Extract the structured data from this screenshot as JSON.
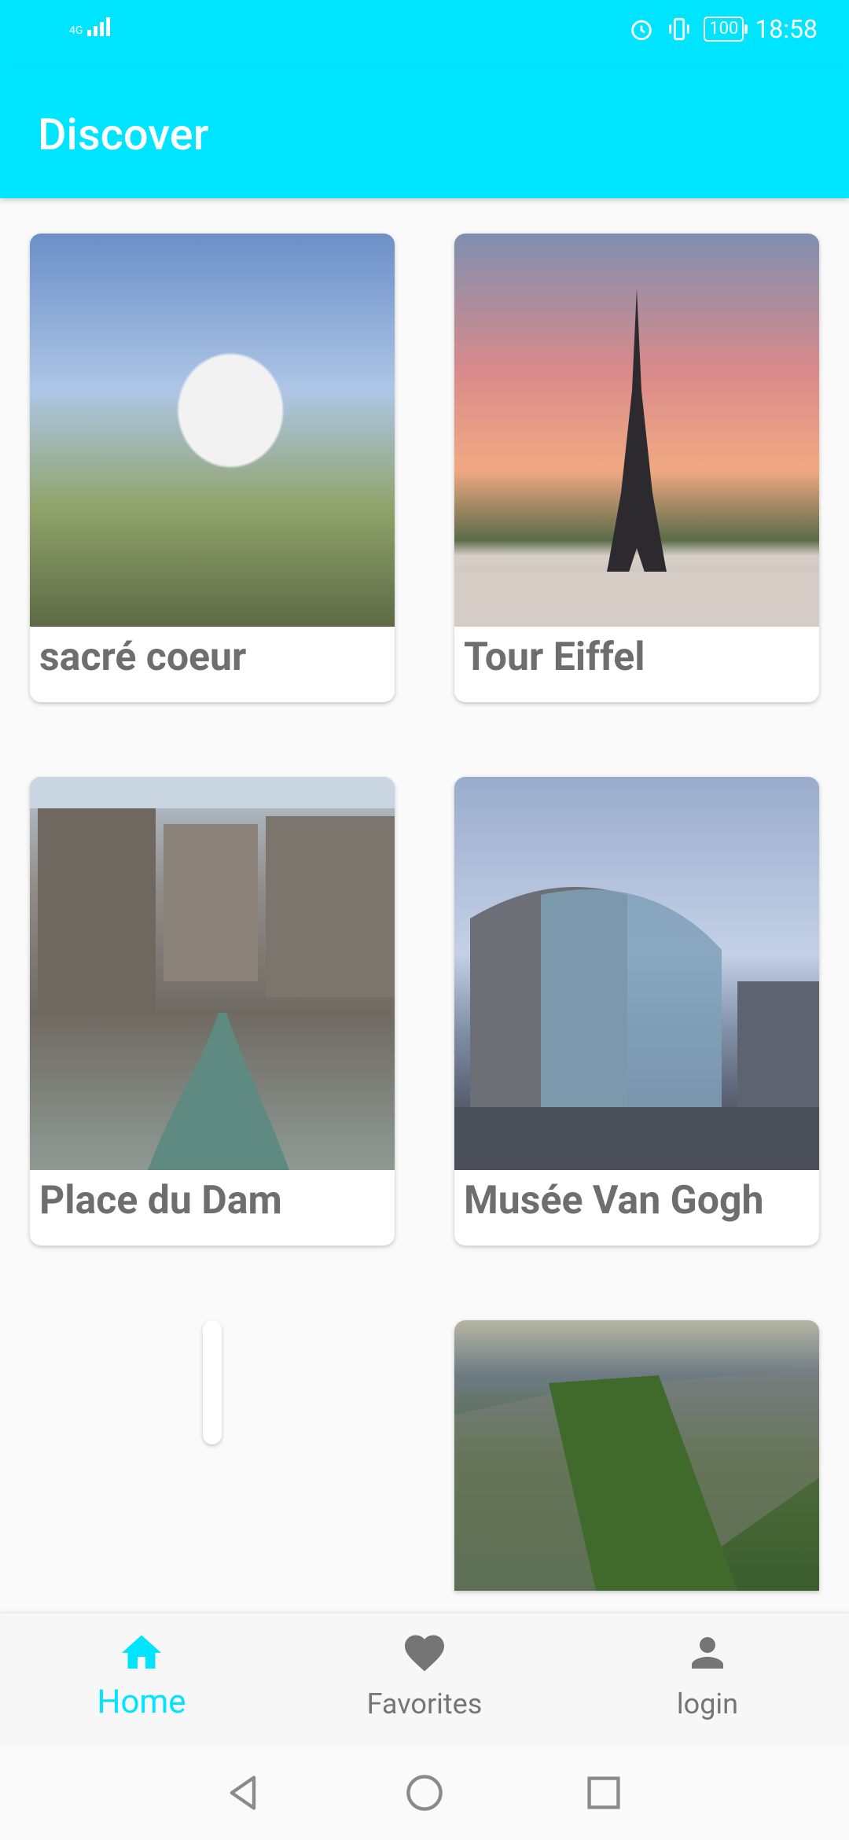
{
  "status_bar": {
    "network": "4G",
    "battery": "100",
    "time": "18:58"
  },
  "app_bar": {
    "title": "Discover"
  },
  "cards": [
    {
      "label": "sacré coeur"
    },
    {
      "label": "Tour Eiffel"
    },
    {
      "label": "Place du Dam"
    },
    {
      "label": "Musée Van Gogh"
    }
  ],
  "bottom_nav": {
    "home_label": "Home",
    "favorites_label": "Favorites",
    "login_label": "login"
  },
  "colors": {
    "accent": "#00e5ff",
    "inactive": "#757575"
  }
}
